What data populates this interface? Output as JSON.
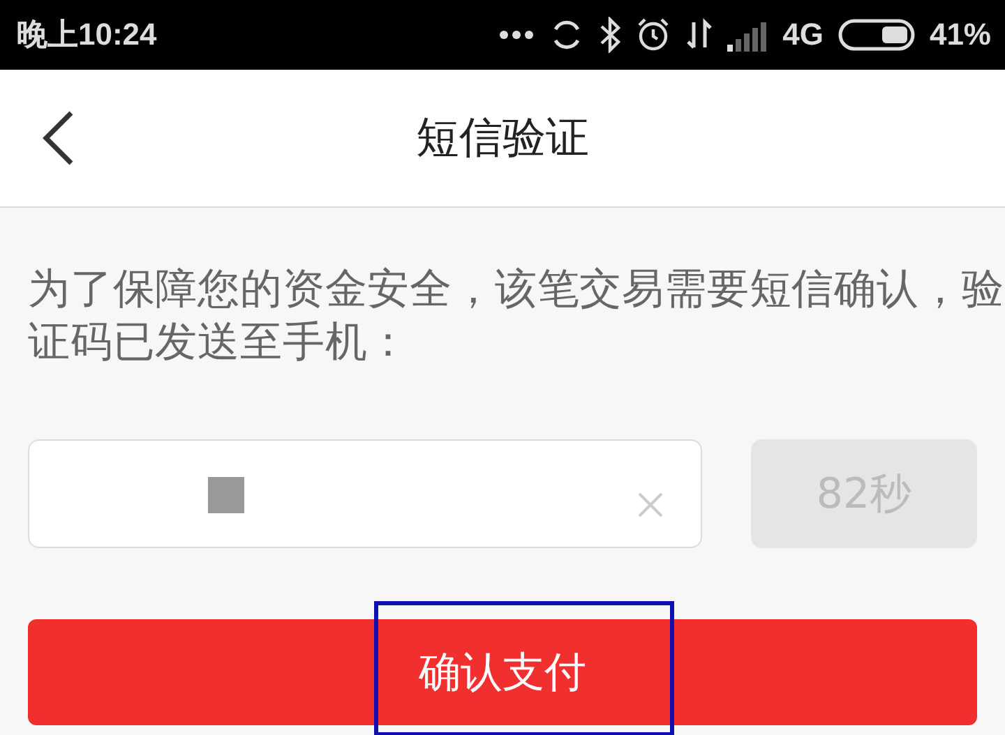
{
  "status_bar": {
    "time": "晚上10:24",
    "network": "4G",
    "battery": "41%"
  },
  "header": {
    "title": "短信验证"
  },
  "message": "为了保障您的资金安全，该笔交易需要短信确认，验证码已发送至手机：",
  "code_field": {
    "clearable": true
  },
  "resend_button": {
    "label": "82秒",
    "disabled": true
  },
  "confirm_button": {
    "label": "确认支付",
    "highlighted": true
  }
}
